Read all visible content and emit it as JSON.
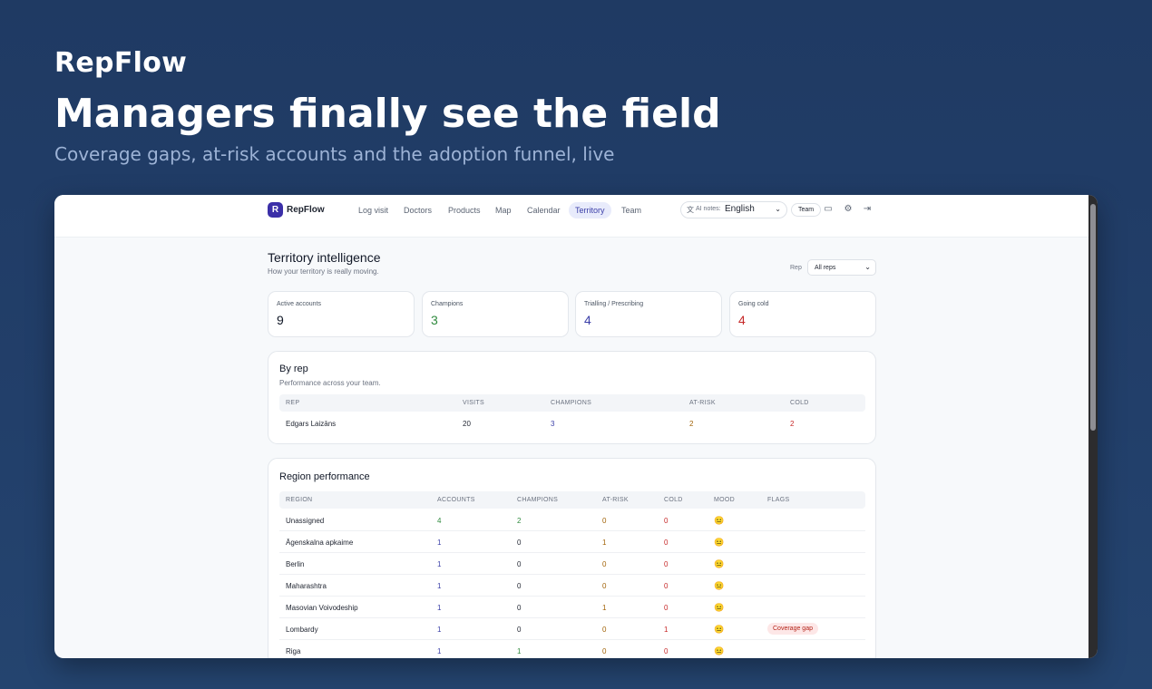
{
  "hero": {
    "brand": "RepFlow",
    "title": "Managers finally see the field",
    "subtitle": "Coverage gaps, at-risk accounts and the adoption funnel, live"
  },
  "app": {
    "logo_letter": "R",
    "logo_text": "RepFlow",
    "nav": [
      "Log visit",
      "Doctors",
      "Products",
      "Map",
      "Calendar",
      "Territory",
      "Team"
    ],
    "active_nav": "Territory",
    "ai_notes_label": "AI notes:",
    "ai_notes_value": "English",
    "team_button": "Team",
    "icons": [
      "translate-icon",
      "card-icon",
      "gear-icon",
      "logout-icon"
    ]
  },
  "page": {
    "title": "Territory intelligence",
    "subtitle": "How your territory is really moving.",
    "rep_filter_label": "Rep",
    "rep_filter_value": "All reps"
  },
  "kpis": [
    {
      "label": "Active accounts",
      "value": "9",
      "color": "#111827"
    },
    {
      "label": "Champions",
      "value": "3",
      "color": "#2f8a3e"
    },
    {
      "label": "Trialling / Prescribing",
      "value": "4",
      "color": "#3b3fa8"
    },
    {
      "label": "Going cold",
      "value": "4",
      "color": "#c62828"
    }
  ],
  "by_rep": {
    "title": "By rep",
    "subtitle": "Performance across your team.",
    "headers": [
      "REP",
      "VISITS",
      "CHAMPIONS",
      "AT-RISK",
      "COLD"
    ],
    "rows": [
      {
        "rep": "Edgars Laizāns",
        "visits": "20",
        "champions": "3",
        "at_risk": "2",
        "cold": "2"
      }
    ]
  },
  "regions": {
    "title": "Region performance",
    "headers": [
      "REGION",
      "ACCOUNTS",
      "CHAMPIONS",
      "AT-RISK",
      "COLD",
      "MOOD",
      "FLAGS"
    ],
    "rows": [
      {
        "region": "Unassigned",
        "accounts": "4",
        "champions": "2",
        "at_risk": "0",
        "cold": "0",
        "mood": "😐",
        "flag": ""
      },
      {
        "region": "Āgenskalna apkaime",
        "accounts": "1",
        "champions": "0",
        "at_risk": "1",
        "cold": "0",
        "mood": "😐",
        "flag": ""
      },
      {
        "region": "Berlin",
        "accounts": "1",
        "champions": "0",
        "at_risk": "0",
        "cold": "0",
        "mood": "😐",
        "flag": ""
      },
      {
        "region": "Maharashtra",
        "accounts": "1",
        "champions": "0",
        "at_risk": "0",
        "cold": "0",
        "mood": "😐",
        "flag": ""
      },
      {
        "region": "Masovian Voivodeship",
        "accounts": "1",
        "champions": "0",
        "at_risk": "1",
        "cold": "0",
        "mood": "😐",
        "flag": ""
      },
      {
        "region": "Lombardy",
        "accounts": "1",
        "champions": "0",
        "at_risk": "0",
        "cold": "1",
        "mood": "😐",
        "flag": "Coverage gap"
      },
      {
        "region": "Riga",
        "accounts": "1",
        "champions": "1",
        "at_risk": "0",
        "cold": "0",
        "mood": "😐",
        "flag": ""
      }
    ]
  }
}
